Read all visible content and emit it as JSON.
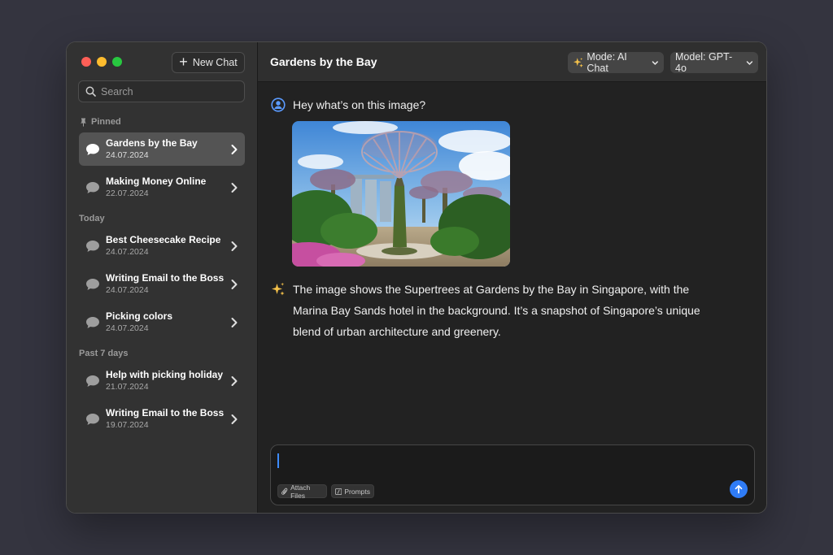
{
  "colors": {
    "backdrop": "#34343f",
    "sidebar": "#323232",
    "main": "#222222",
    "accent": "#2f7cf6",
    "selected": "#545454"
  },
  "sidebar": {
    "new_chat_label": "New Chat",
    "search_placeholder": "Search",
    "sections": {
      "pinned": "Pinned",
      "today": "Today",
      "past": "Past 7 days"
    },
    "items": [
      {
        "title": "Gardens by the Bay",
        "date": "24.07.2024",
        "active": true
      },
      {
        "title": "Making Money Online",
        "date": "22.07.2024"
      },
      {
        "title": "Best Cheesecake Recipe",
        "date": "24.07.2024"
      },
      {
        "title": "Writing Email to the Boss",
        "date": "24.07.2024"
      },
      {
        "title": "Picking colors",
        "date": "24.07.2024"
      },
      {
        "title": "Help with picking holiday",
        "date": "21.07.2024"
      },
      {
        "title": "Writing Email to the Boss",
        "date": "19.07.2024"
      }
    ]
  },
  "header": {
    "title": "Gardens by the Bay",
    "mode_label": "Mode: AI Chat",
    "model_label": "Model: GPT-4o"
  },
  "conversation": {
    "user_message": "Hey what’s on this image?",
    "ai_message": "The image shows the Supertrees at Gardens by the Bay in Singapore, with the Marina Bay Sands hotel in the background. It’s a snapshot of Singapore’s unique blend of urban architecture and greenery."
  },
  "composer": {
    "input_value": "",
    "attach_label": "Attach Files",
    "prompts_label": "Prompts"
  },
  "icons": {
    "new_chat": "plus-icon",
    "search": "search-icon",
    "pinned": "pin-icon",
    "chat": "speech-bubble-icon",
    "row_chevron": "chevron-right-icon",
    "mode": "sparkles-icon",
    "user_avatar": "user-circle-icon",
    "ai_avatar": "sparkles-icon",
    "attach": "paperclip-icon",
    "prompts": "slash-icon",
    "send": "arrow-up-icon"
  }
}
